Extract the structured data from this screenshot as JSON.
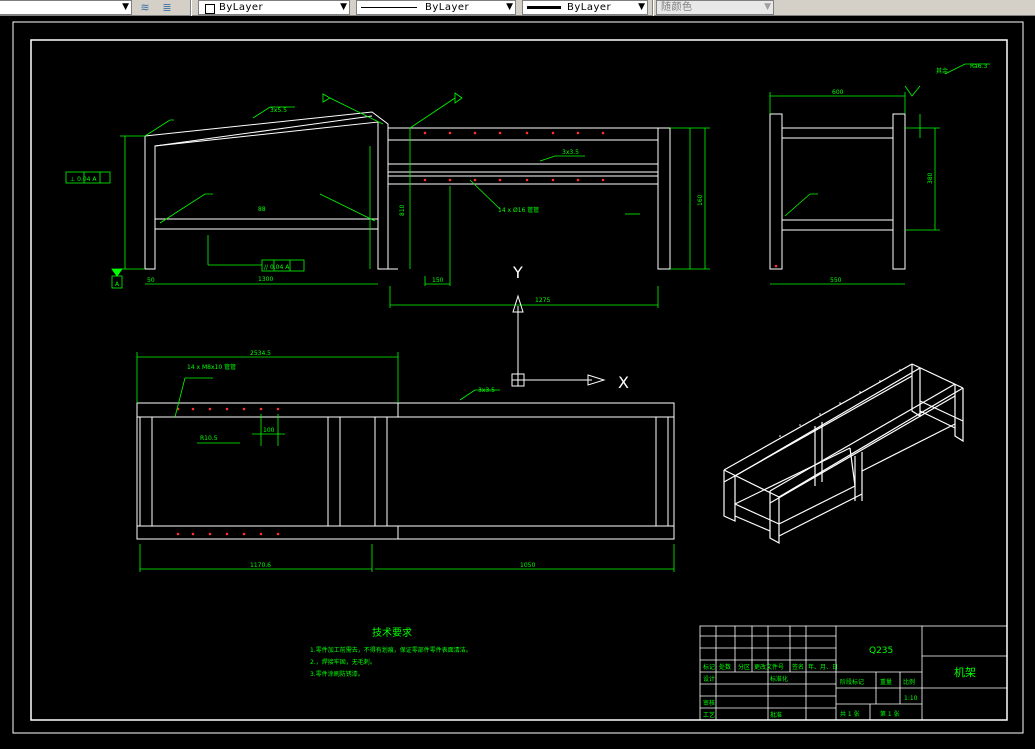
{
  "toolbar": {
    "layer_dropdown_value": "",
    "color_dropdown_value": "ByLayer",
    "linetype_dropdown_value": "ByLayer",
    "lineweight_dropdown_value": "ByLayer",
    "plotstyle_dropdown_value": "随颜色",
    "icons": [
      "layer-manager-icon",
      "layer-previous-icon"
    ]
  },
  "drawing": {
    "axis_y_label": "Y",
    "axis_x_label": "X",
    "front_view": {
      "dim_width_left": "1300",
      "dim_width_right": "1275",
      "dim_height_left": "",
      "dim_150": "150",
      "dim_160": "160",
      "dim_810": "810",
      "dim_88": "88",
      "dim_50": "50",
      "tube_note": "14 x Ø16 管管",
      "weld_1": "3x5.5",
      "weld_2": "3x3.5",
      "perp_tol": "⊥ 0.04 A",
      "para_tol": "// 0.04 A",
      "datum": "A"
    },
    "side_view": {
      "dim_top": "600",
      "dim_bottom": "550",
      "dim_height": "380",
      "rough": "Ra6.3",
      "rough_label": "其余"
    },
    "top_view": {
      "dim_total": "2534.5",
      "dim_left": "1170.6",
      "dim_right": "1050",
      "dim_100": "100",
      "hole_note": "14 x M8x10 管管",
      "r_note": "R10.5",
      "weld_3": "3x3.5"
    },
    "tech_title": "技术要求",
    "tech_items": [
      "1.零件加工前需去，不得有划痕，保证零部件零件表面清洁。",
      "2.，焊接牢固，无毛刺。",
      "3.零件涂刷防锈漆。"
    ]
  },
  "title_block": {
    "material": "Q235",
    "part_name": "机架",
    "scale": "1:10",
    "headers": [
      "标记",
      "处数",
      "分区",
      "更改文件号",
      "签名",
      "年、月、日"
    ],
    "row_design": "设计",
    "row_standard": "标准化",
    "row_review": "审核",
    "row_process": "工艺",
    "row_approve": "批准",
    "stage_label": "阶段标记",
    "weight_label": "重量",
    "scale_label": "比例",
    "sheets": "共 1 张",
    "sheet_no": "第 1 张"
  }
}
